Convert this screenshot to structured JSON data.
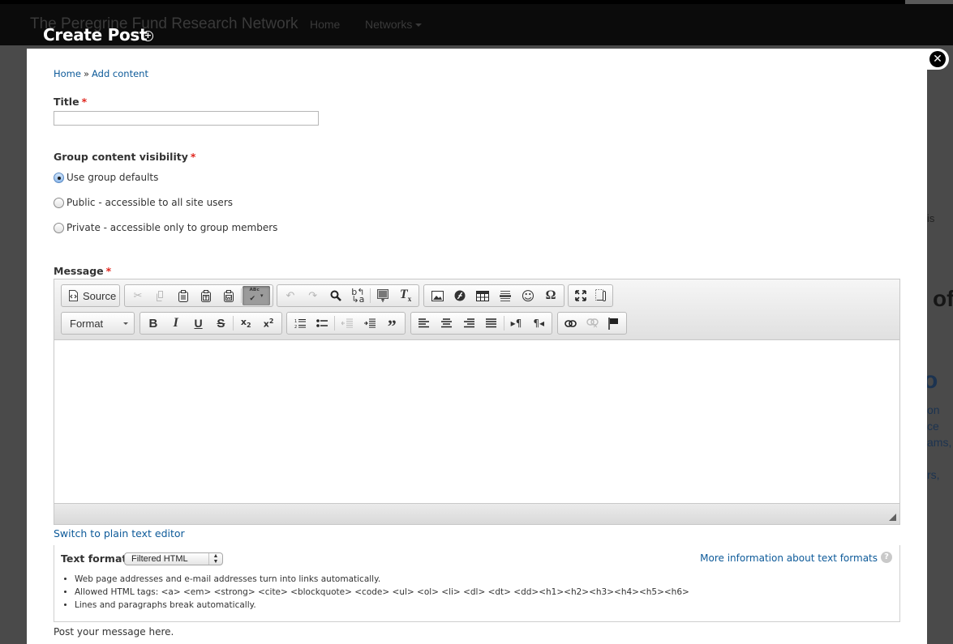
{
  "background_site": {
    "brand": "The Peregrine Fund Research Network",
    "nav": [
      {
        "label": "Home"
      },
      {
        "label": "Networks"
      }
    ],
    "fragments": {
      "is": "is",
      "of": "of",
      "o": "o",
      "line1": "on",
      "line2": "ce",
      "line3": "ams,",
      "line4": "rs,"
    }
  },
  "modal": {
    "title": "Create Post",
    "title_icon": "plus-circle-icon",
    "close_icon": "close-circle-icon"
  },
  "breadcrumb": [
    {
      "label": "Home"
    },
    {
      "label": "Add content"
    }
  ],
  "breadcrumb_separator": "»",
  "form": {
    "title": {
      "label": "Title",
      "required_mark": "*",
      "value": "",
      "placeholder": ""
    },
    "visibility": {
      "label": "Group content visibility",
      "required_mark": "*",
      "options": [
        {
          "label": "Use group defaults",
          "checked": true
        },
        {
          "label": "Public - accessible to all site users",
          "checked": false
        },
        {
          "label": "Private - accessible only to group members",
          "checked": false
        }
      ]
    },
    "message": {
      "label": "Message",
      "required_mark": "*",
      "toolbar": {
        "source_label": "Source",
        "format_label": "Format",
        "row1": [
          "source",
          "cut",
          "copy",
          "paste",
          "paste-text",
          "paste-from-word",
          "spellcheck",
          "undo",
          "redo",
          "find",
          "replace",
          "select-all",
          "remove-format",
          "image",
          "flash",
          "table",
          "horizontal-rule",
          "smiley",
          "special-char",
          "maximize",
          "show-blocks"
        ],
        "row2": [
          "format",
          "bold",
          "italic",
          "underline",
          "strike",
          "subscript",
          "superscript",
          "numbered-list",
          "bulleted-list",
          "outdent",
          "indent",
          "blockquote",
          "align-left",
          "align-center",
          "align-right",
          "justify",
          "ltr",
          "rtl",
          "link",
          "unlink",
          "anchor"
        ]
      },
      "value": ""
    },
    "switch_editor_link": "Switch to plain text editor",
    "text_format": {
      "label": "Text format",
      "selected": "Filtered HTML",
      "more_info_link": "More information about text formats",
      "tips": [
        "Web page addresses and e-mail addresses turn into links automatically.",
        "Allowed HTML tags: <a> <em> <strong> <cite> <blockquote> <code> <ul> <ol> <li> <dl> <dt> <dd><h1><h2><h3><h4><h5><h6>",
        "Lines and paragraphs break automatically."
      ]
    },
    "description": "Post your message here."
  },
  "colors": {
    "link": "#0d5a99",
    "required": "#e0261e",
    "overlay": "#4a4a4a",
    "navbar": "#0b0b0b"
  }
}
